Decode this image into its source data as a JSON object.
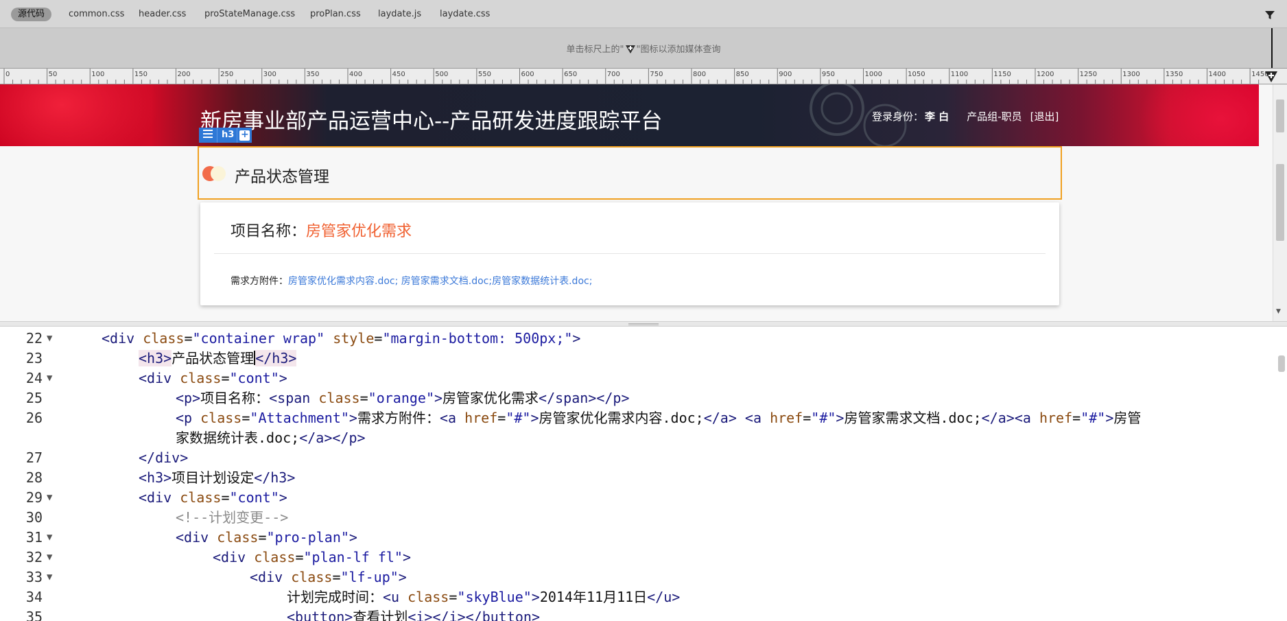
{
  "tabs": [
    {
      "label": "源代码",
      "active": true
    },
    {
      "label": "common.css"
    },
    {
      "label": "header.css"
    },
    {
      "label": "proStateManage.css"
    },
    {
      "label": "proPlan.css"
    },
    {
      "label": "laydate.js"
    },
    {
      "label": "laydate.css"
    }
  ],
  "media_query": {
    "hint_before": "单击标尺上的\"",
    "hint_after": "\"图标以添加媒体查询"
  },
  "ruler": {
    "labels": [
      "0",
      "50",
      "100",
      "150",
      "200",
      "250",
      "300",
      "350",
      "400",
      "450",
      "500",
      "550",
      "600",
      "650",
      "700",
      "750",
      "800",
      "850",
      "900",
      "950",
      "1000",
      "1050",
      "1100",
      "1150",
      "1200",
      "1250",
      "1300",
      "1350",
      "1400",
      "1450"
    ]
  },
  "preview": {
    "site_title": "新房事业部产品运营中心--产品研发进度跟踪平台",
    "login_label": "登录身份：",
    "login_user": "李 白",
    "login_group": "产品组-职员",
    "logout": "[退出]",
    "toolbar_tag": "h3",
    "toolbar_add": "+",
    "h3_text": "产品状态管理",
    "project_label": "项目名称：",
    "project_name": "房管家优化需求",
    "attach_label": "需求方附件：",
    "attach_links": [
      "房管家优化需求内容.doc;",
      "房管家需求文档.doc;",
      "房管家数据统计表.doc;"
    ]
  },
  "code": {
    "line_numbers": [
      "22",
      "23",
      "24",
      "25",
      "26",
      "",
      "27",
      "28",
      "29",
      "30",
      "31",
      "32",
      "33",
      "34",
      "35"
    ],
    "folds": [
      "▼",
      "",
      "▼",
      "",
      "",
      "",
      "",
      "",
      "▼",
      "",
      "▼",
      "▼",
      "▼",
      "",
      ""
    ],
    "l22": {
      "tag": "div",
      "attr1": "class",
      "val1": "\"container wrap\"",
      "attr2": "style",
      "val2": "\"margin-bottom: 500px;\""
    },
    "l23": {
      "tag": "h3",
      "text": "产品状态管理"
    },
    "l24": {
      "tag": "div",
      "attr1": "class",
      "val1": "\"cont\""
    },
    "l25": {
      "text1": "项目名称：",
      "attr1": "class",
      "val1": "\"orange\"",
      "text2": "房管家优化需求"
    },
    "l26": {
      "attr1": "class",
      "val1": "\"Attachment\"",
      "text1": "需求方附件：",
      "href": "\"#\"",
      "link1": "房管家优化需求内容.doc;",
      "link2": "房管家需求文档.doc;",
      "link3a": "房管",
      "link3b": "家数据统计表.doc;"
    },
    "l28": {
      "text": "项目计划设定"
    },
    "l29": {
      "val1": "\"cont\""
    },
    "l30": {
      "comment": "<!--计划变更-->"
    },
    "l31": {
      "val1": "\"pro-plan\""
    },
    "l32": {
      "val1": "\"plan-lf fl\""
    },
    "l33": {
      "val1": "\"lf-up\""
    },
    "l34": {
      "text1": "计划完成时间：",
      "tag": "u",
      "val1": "\"skyBlue\"",
      "text2": "2014年11月11日"
    },
    "l35": {
      "text1": "查看计划"
    }
  },
  "colors": {
    "accent": "#2e78d6",
    "highlight_border": "#f0a020",
    "orange_text": "#f06030",
    "link": "#3a78d8"
  }
}
